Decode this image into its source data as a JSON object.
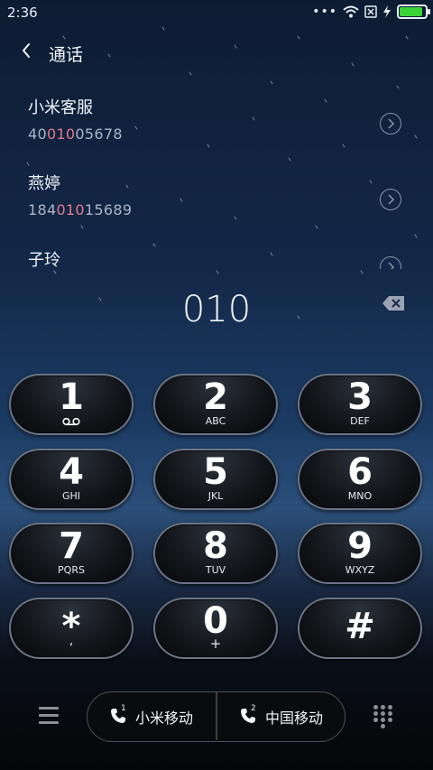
{
  "status_bar": {
    "time": "2:36",
    "dots": "•••",
    "battery_color": "#39d339"
  },
  "header": {
    "title": "通话",
    "back_icon": "chevron-left-icon"
  },
  "contacts": [
    {
      "name": "小米客服",
      "num_pre": "40",
      "num_hl": "010",
      "num_post": "05678"
    },
    {
      "name": "燕婷",
      "num_pre": "184",
      "num_hl": "010",
      "num_post": "15689"
    },
    {
      "name": "子玲",
      "num_pre": "",
      "num_hl": "",
      "num_post": ""
    }
  ],
  "dialed_number": "010",
  "keys": [
    {
      "digit": "1",
      "letters": ""
    },
    {
      "digit": "2",
      "letters": "ABC"
    },
    {
      "digit": "3",
      "letters": "DEF"
    },
    {
      "digit": "4",
      "letters": "GHI"
    },
    {
      "digit": "5",
      "letters": "JKL"
    },
    {
      "digit": "6",
      "letters": "MNO"
    },
    {
      "digit": "7",
      "letters": "PQRS"
    },
    {
      "digit": "8",
      "letters": "TUV"
    },
    {
      "digit": "9",
      "letters": "WXYZ"
    },
    {
      "digit": "*",
      "letters": ","
    },
    {
      "digit": "0",
      "letters": "+"
    },
    {
      "digit": "#",
      "letters": ""
    }
  ],
  "bottom": {
    "sim1_label": "小米移动",
    "sim1_index": "1",
    "sim2_label": "中国移动",
    "sim2_index": "2"
  },
  "highlight_color": "#e07b8e"
}
